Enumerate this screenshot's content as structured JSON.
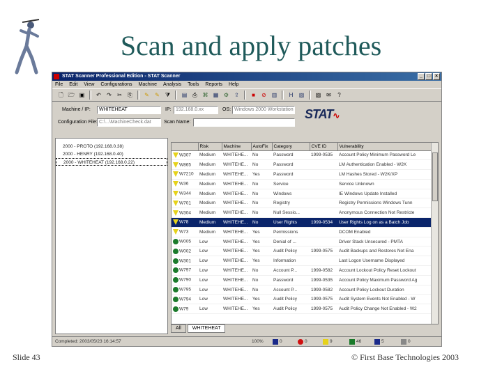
{
  "slide": {
    "title": "Scan and apply patches",
    "number": "Slide 43",
    "copyright": "© First Base Technologies 2003"
  },
  "window": {
    "title": "STAT Scanner Professional Edition - STAT Scanner",
    "controls": [
      "_",
      "□",
      "×"
    ]
  },
  "menu": [
    "File",
    "Edit",
    "View",
    "Configurations",
    "Machine",
    "Analysis",
    "Tools",
    "Reports",
    "Help"
  ],
  "form": {
    "machine_label": "Machine / IP:",
    "machine_value": "WHITEHEAT",
    "ip_label": "IP:",
    "ip_value": "192.168.0.xx",
    "os_label": "OS:",
    "os_value": "Windows 2000 Workstation",
    "config_label": "Configuration File:",
    "config_value": "C:\\...\\MachineCheck.dat",
    "scan_label": "Scan Name:",
    "scan_value": "",
    "logo_text": "STAT"
  },
  "tree": [
    "2000 - PROTO (192.168.0.38)",
    "2000 - HENRY (192.168.0.40)",
    "2000 - WHITEHEAT (192.168.0.22)"
  ],
  "grid": {
    "columns": [
      "",
      "Risk",
      "Machine",
      "AutoFix",
      "Category",
      "CVE ID",
      "Vulnerability"
    ],
    "rows": [
      {
        "sev": "warn",
        "id": "W307",
        "risk": "Medium",
        "machine": "WHITEHE...",
        "autofix": "No",
        "category": "Password",
        "cve": "1999-0535",
        "vuln": "Account Policy Minimum Password Le"
      },
      {
        "sev": "warn",
        "id": "W865",
        "risk": "Medium",
        "machine": "WHITEHE...",
        "autofix": "No",
        "category": "Password",
        "cve": "",
        "vuln": "LM Authentication Enabled - W2K"
      },
      {
        "sev": "warn",
        "id": "W7210",
        "risk": "Medium",
        "machine": "WHITEHE...",
        "autofix": "Yes",
        "category": "Password",
        "cve": "",
        "vuln": "LM Hashes Stored - W2K/XP"
      },
      {
        "sev": "warn",
        "id": "W36",
        "risk": "Medium",
        "machine": "WHITEHE...",
        "autofix": "No",
        "category": "Service",
        "cve": "",
        "vuln": "Service Unknown"
      },
      {
        "sev": "warn",
        "id": "W344",
        "risk": "Medium",
        "machine": "WHITEHE...",
        "autofix": "No",
        "category": "Windows",
        "cve": "",
        "vuln": "IE Windows Update Installed"
      },
      {
        "sev": "warn",
        "id": "W701",
        "risk": "Medium",
        "machine": "WHITEHE...",
        "autofix": "No",
        "category": "Registry",
        "cve": "",
        "vuln": "Registry Permissions Windows Tunn"
      },
      {
        "sev": "warn",
        "id": "W304",
        "risk": "Medium",
        "machine": "WHITEHE...",
        "autofix": "No",
        "category": "Null Sessio...",
        "cve": "",
        "vuln": "Anonymous Connection Not Restricte"
      },
      {
        "sev": "warn",
        "id": "W78",
        "risk": "Medium",
        "machine": "WHITEHE...",
        "autofix": "No",
        "category": "User Rights",
        "cve": "1999-0534",
        "vuln": "User Rights Log on as a Batch Job",
        "selected": true
      },
      {
        "sev": "warn",
        "id": "W73",
        "risk": "Medium",
        "machine": "WHITEHE...",
        "autofix": "Yes",
        "category": "Permissions",
        "cve": "",
        "vuln": "DCOM Enabled"
      },
      {
        "sev": "low",
        "id": "W005",
        "risk": "Low",
        "machine": "WHITEHE...",
        "autofix": "Yes",
        "category": "Denial of ...",
        "cve": "",
        "vuln": "Driver Stack Unsecured - PMTA"
      },
      {
        "sev": "low",
        "id": "W002",
        "risk": "Low",
        "machine": "WHITEHE...",
        "autofix": "Yes",
        "category": "Audit Policy",
        "cve": "1999-0575",
        "vuln": "Audit Backups and Restores Not Ena"
      },
      {
        "sev": "low",
        "id": "W301",
        "risk": "Low",
        "machine": "WHITEHE...",
        "autofix": "Yes",
        "category": "Information",
        "cve": "",
        "vuln": "Last Logon Username Displayed"
      },
      {
        "sev": "low",
        "id": "W797",
        "risk": "Low",
        "machine": "WHITEHE...",
        "autofix": "No",
        "category": "Account P...",
        "cve": "1999-0582",
        "vuln": "Account Lockout Policy Reset Lockout"
      },
      {
        "sev": "low",
        "id": "W790",
        "risk": "Low",
        "machine": "WHITEHE...",
        "autofix": "No",
        "category": "Password",
        "cve": "1999-0535",
        "vuln": "Account Policy Maximum Password Ag"
      },
      {
        "sev": "low",
        "id": "W795",
        "risk": "Low",
        "machine": "WHITEHE...",
        "autofix": "No",
        "category": "Account P...",
        "cve": "1999-0582",
        "vuln": "Account Policy Lockout Duration"
      },
      {
        "sev": "low",
        "id": "W794",
        "risk": "Low",
        "machine": "WHITEHE...",
        "autofix": "Yes",
        "category": "Audit Policy",
        "cve": "1999-0575",
        "vuln": "Audit System Events Not Enabled - W"
      },
      {
        "sev": "low",
        "id": "W79",
        "risk": "Low",
        "machine": "WHITEHE...",
        "autofix": "Yes",
        "category": "Audit Policy",
        "cve": "1999-0575",
        "vuln": "Audit Policy Change Not Enabled - W2"
      }
    ]
  },
  "tabs": [
    "All",
    "WHITEHEAT"
  ],
  "status": {
    "left": "Completed: 2003/05/23 16:14:57",
    "percent": "100%",
    "counts": [
      {
        "value": "0",
        "color": "#1a2a8a"
      },
      {
        "value": "0",
        "color": "#d01010"
      },
      {
        "value": "9",
        "color": "#e6d21a"
      },
      {
        "value": "46",
        "color": "#1a7a2a"
      },
      {
        "value": "5",
        "color": "#1a2a8a"
      },
      {
        "value": "0",
        "color": "#888888"
      }
    ]
  },
  "colors": {
    "title": "#1f5a5a",
    "titlebar": "#0a246a",
    "selection": "#0a246a",
    "medium_risk": "#e6d21a",
    "low_risk": "#1a7a2a"
  }
}
